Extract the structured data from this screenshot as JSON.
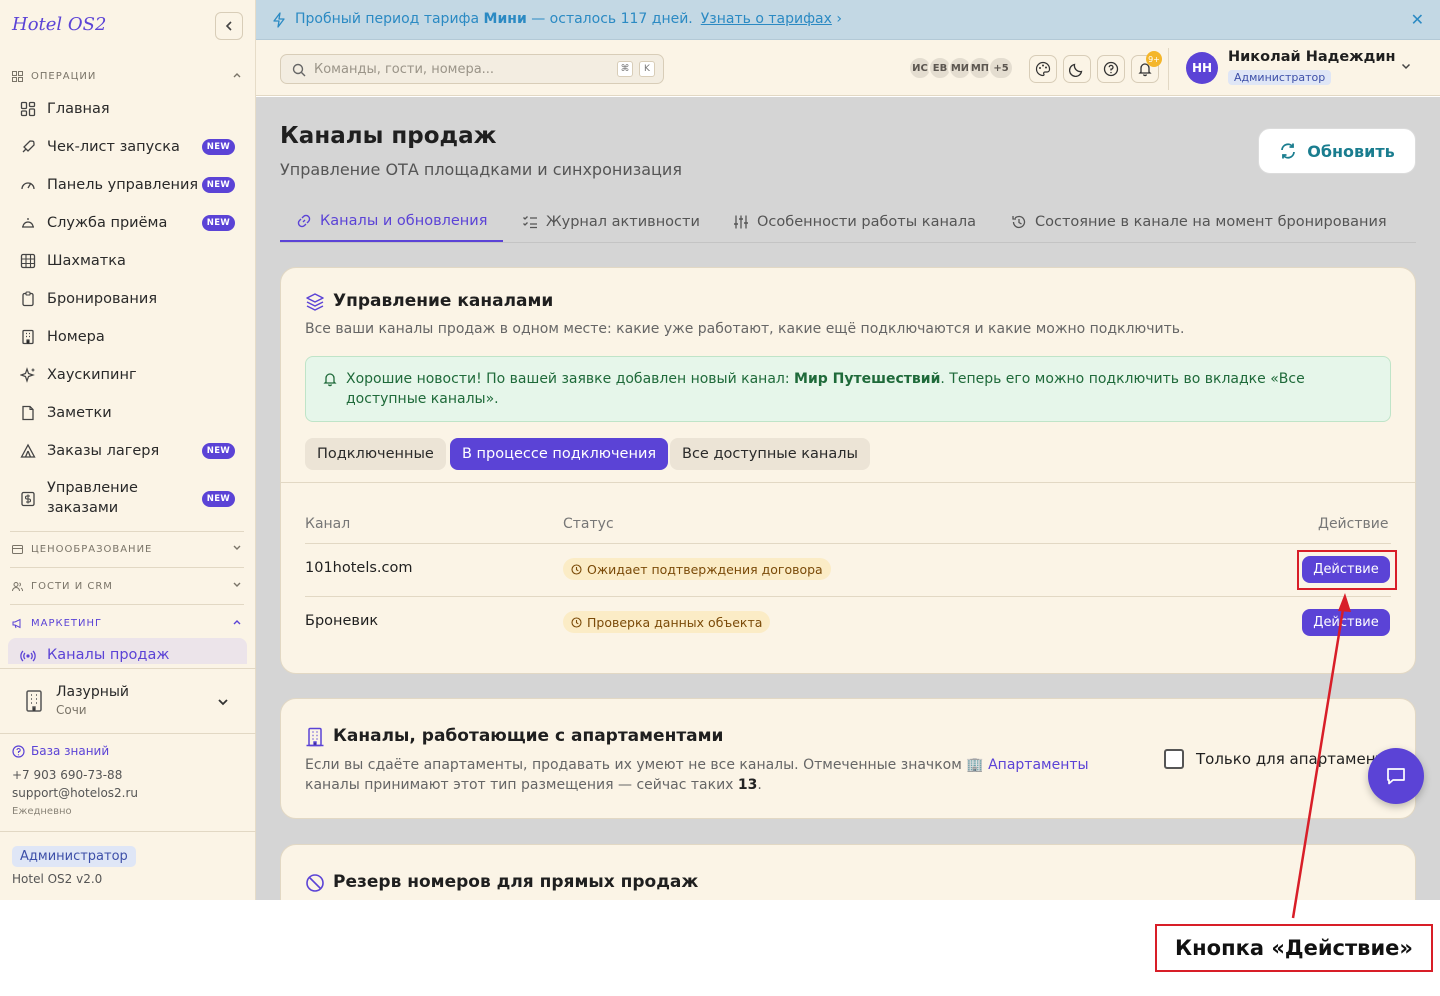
{
  "sidebar": {
    "brand": "Hotel OS2",
    "sections": {
      "operations": "ОПЕРАЦИИ",
      "pricing": "ЦЕНООБРАЗОВАНИЕ",
      "guests": "ГОСТИ И CRM",
      "marketing": "МАРКЕТИНГ"
    },
    "items": [
      {
        "label": "Главная",
        "icon": "grid-icon",
        "badge": ""
      },
      {
        "label": "Чек-лист запуска",
        "icon": "rocket-icon",
        "badge": "NEW"
      },
      {
        "label": "Панель управления",
        "icon": "gauge-icon",
        "badge": "NEW"
      },
      {
        "label": "Служба приёма",
        "icon": "bell-desk-icon",
        "badge": "NEW"
      },
      {
        "label": "Шахматка",
        "icon": "table-icon",
        "badge": ""
      },
      {
        "label": "Бронирования",
        "icon": "clipboard-icon",
        "badge": ""
      },
      {
        "label": "Номера",
        "icon": "building-icon",
        "badge": ""
      },
      {
        "label": "Хаускипинг",
        "icon": "sparkles-icon",
        "badge": ""
      },
      {
        "label": "Заметки",
        "icon": "note-icon",
        "badge": ""
      },
      {
        "label": "Заказы лагеря",
        "icon": "tent-icon",
        "badge": "NEW"
      },
      {
        "label": "Управление",
        "label2": "заказами",
        "icon": "dollar-icon",
        "badge": "NEW"
      }
    ],
    "active_item": "Каналы продаж",
    "hotel": {
      "name": "Лазурный",
      "city": "Сочи"
    },
    "knowledge_base": "База знаний",
    "phone": "+7 903 690-73-88",
    "email": "support@hotelos2.ru",
    "schedule": "Ежедневно",
    "role": "Администратор",
    "version": "Hotel OS2 v2.0"
  },
  "banner": {
    "text_before": "Пробный период тарифа ",
    "plan": "Мини",
    "text_after": " — осталось 117 дней.",
    "link": "Узнать о тарифах",
    "link_suffix": "›",
    "close": "✕"
  },
  "topbar": {
    "search_placeholder": "Команды, гости, номера...",
    "kbd1": "⌘",
    "kbd2": "K",
    "avatars": [
      "ИС",
      "ЕВ",
      "МИ",
      "МП",
      "+5"
    ],
    "notif_count": "9+",
    "user": {
      "initials": "НН",
      "name": "Николай Надеждин",
      "role": "Администратор"
    }
  },
  "page": {
    "title": "Каналы продаж",
    "subtitle": "Управление ОТА площадками и синхронизация",
    "refresh": "Обновить",
    "tabs": [
      "Каналы и обновления",
      "Журнал активности",
      "Особенности работы канала",
      "Состояние в канале на момент бронирования"
    ]
  },
  "channels_card": {
    "title": "Управление каналами",
    "desc": "Все ваши каналы продаж в одном месте: какие уже работают, какие ещё подключаются и какие можно подключить.",
    "news_before": "Хорошие новости! По вашей заявке добавлен новый канал: ",
    "news_channel": "Мир Путешествий",
    "news_after": ". Теперь его можно подключить во вкладке «Все доступные каналы».",
    "segments": [
      "Подключенные",
      "В процессе подключения",
      "Все доступные каналы"
    ],
    "columns": [
      "Канал",
      "Статус",
      "Действие"
    ],
    "rows": [
      {
        "channel": "101hotels.com",
        "status": "Ожидает подтверждения договора",
        "action": "Действие"
      },
      {
        "channel": "Броневик",
        "status": "Проверка данных объекта",
        "action": "Действие"
      }
    ]
  },
  "apartments_card": {
    "title": "Каналы, работающие с апартаментами",
    "desc_before": "Если вы сдаёте апартаменты, продавать их умеют не все каналы. Отмеченные значком 🏢 ",
    "desc_link": "Апартаменты",
    "desc_mid": " каналы принимают этот тип размещения — сейчас таких ",
    "desc_count": "13",
    "desc_end": ".",
    "checkbox_label": "Только для апартаментов"
  },
  "reserve_card": {
    "title": "Резерв номеров для прямых продаж"
  },
  "annotation": {
    "callout": "Кнопка «Действие»"
  },
  "colors": {
    "accent": "#5b43d6",
    "annotation": "#d81e28",
    "banner": "#c3d8e4"
  }
}
